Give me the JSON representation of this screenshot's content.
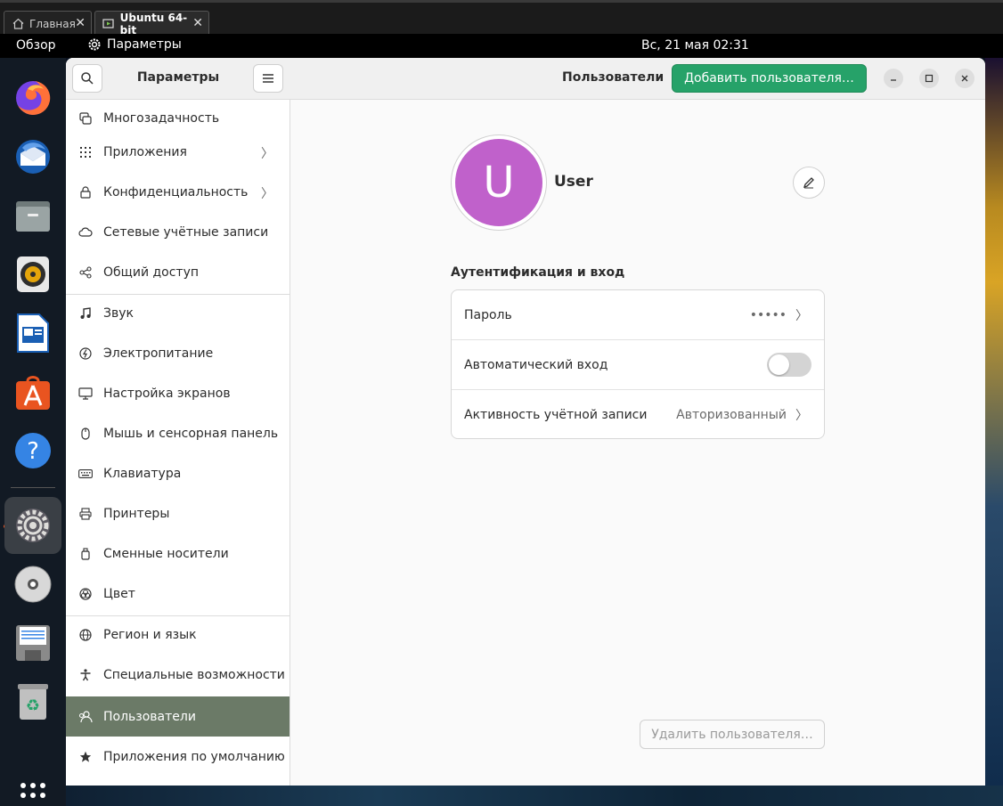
{
  "host_tabs": [
    {
      "label": "Главная"
    },
    {
      "label": "Ubuntu 64-bit"
    }
  ],
  "topbar": {
    "overview": "Обзор",
    "app_name": "Параметры",
    "clock": "Вс, 21 мая  02:31"
  },
  "dock": {
    "apps": [
      "firefox-icon",
      "thunderbird-icon",
      "files-icon",
      "rhythmbox-icon",
      "libreoffice-writer-icon",
      "app-center-icon",
      "help-icon",
      "settings-icon",
      "dvd-icon",
      "floppy-icon",
      "trash-icon",
      "show-apps-icon"
    ]
  },
  "sidebar": {
    "title": "Параметры",
    "items": [
      {
        "label": "Многозадачность",
        "icon": "multitasking-icon",
        "chevron": false
      },
      {
        "label": "Приложения",
        "icon": "apps-icon",
        "chevron": true
      },
      {
        "label": "Конфиденциальность",
        "icon": "lock-icon",
        "chevron": true
      },
      {
        "label": "Сетевые учётные записи",
        "icon": "cloud-icon",
        "chevron": false
      },
      {
        "label": "Общий доступ",
        "icon": "share-icon",
        "chevron": false
      },
      {
        "label": "Звук",
        "icon": "music-note-icon",
        "chevron": false
      },
      {
        "label": "Электропитание",
        "icon": "power-icon",
        "chevron": false
      },
      {
        "label": "Настройка экранов",
        "icon": "display-icon",
        "chevron": false
      },
      {
        "label": "Мышь и сенсорная панель",
        "icon": "mouse-icon",
        "chevron": false
      },
      {
        "label": "Клавиатура",
        "icon": "keyboard-icon",
        "chevron": false
      },
      {
        "label": "Принтеры",
        "icon": "printer-icon",
        "chevron": false
      },
      {
        "label": "Сменные носители",
        "icon": "usb-drive-icon",
        "chevron": false
      },
      {
        "label": "Цвет",
        "icon": "color-icon",
        "chevron": false
      },
      {
        "label": "Регион и язык",
        "icon": "globe-icon",
        "chevron": false
      },
      {
        "label": "Специальные возможности",
        "icon": "accessibility-icon",
        "chevron": false
      },
      {
        "label": "Пользователи",
        "icon": "users-icon",
        "chevron": false,
        "selected": true
      },
      {
        "label": "Приложения по умолчанию",
        "icon": "star-icon",
        "chevron": false
      }
    ]
  },
  "header": {
    "title": "Пользователи",
    "add_user": "Добавить пользователя…"
  },
  "user": {
    "initial": "U",
    "name": "User",
    "avatar_color": "#c061cb"
  },
  "auth": {
    "title": "Аутентификация и вход",
    "password_label": "Пароль",
    "password_value": "•••••",
    "autologin_label": "Автоматический вход",
    "autologin_enabled": false,
    "activity_label": "Активность учётной записи",
    "activity_value": "Авторизованный"
  },
  "delete_user": "Удалить пользователя…",
  "colors": {
    "accent_green": "#26a269",
    "selected_row": "#6b7a67"
  }
}
